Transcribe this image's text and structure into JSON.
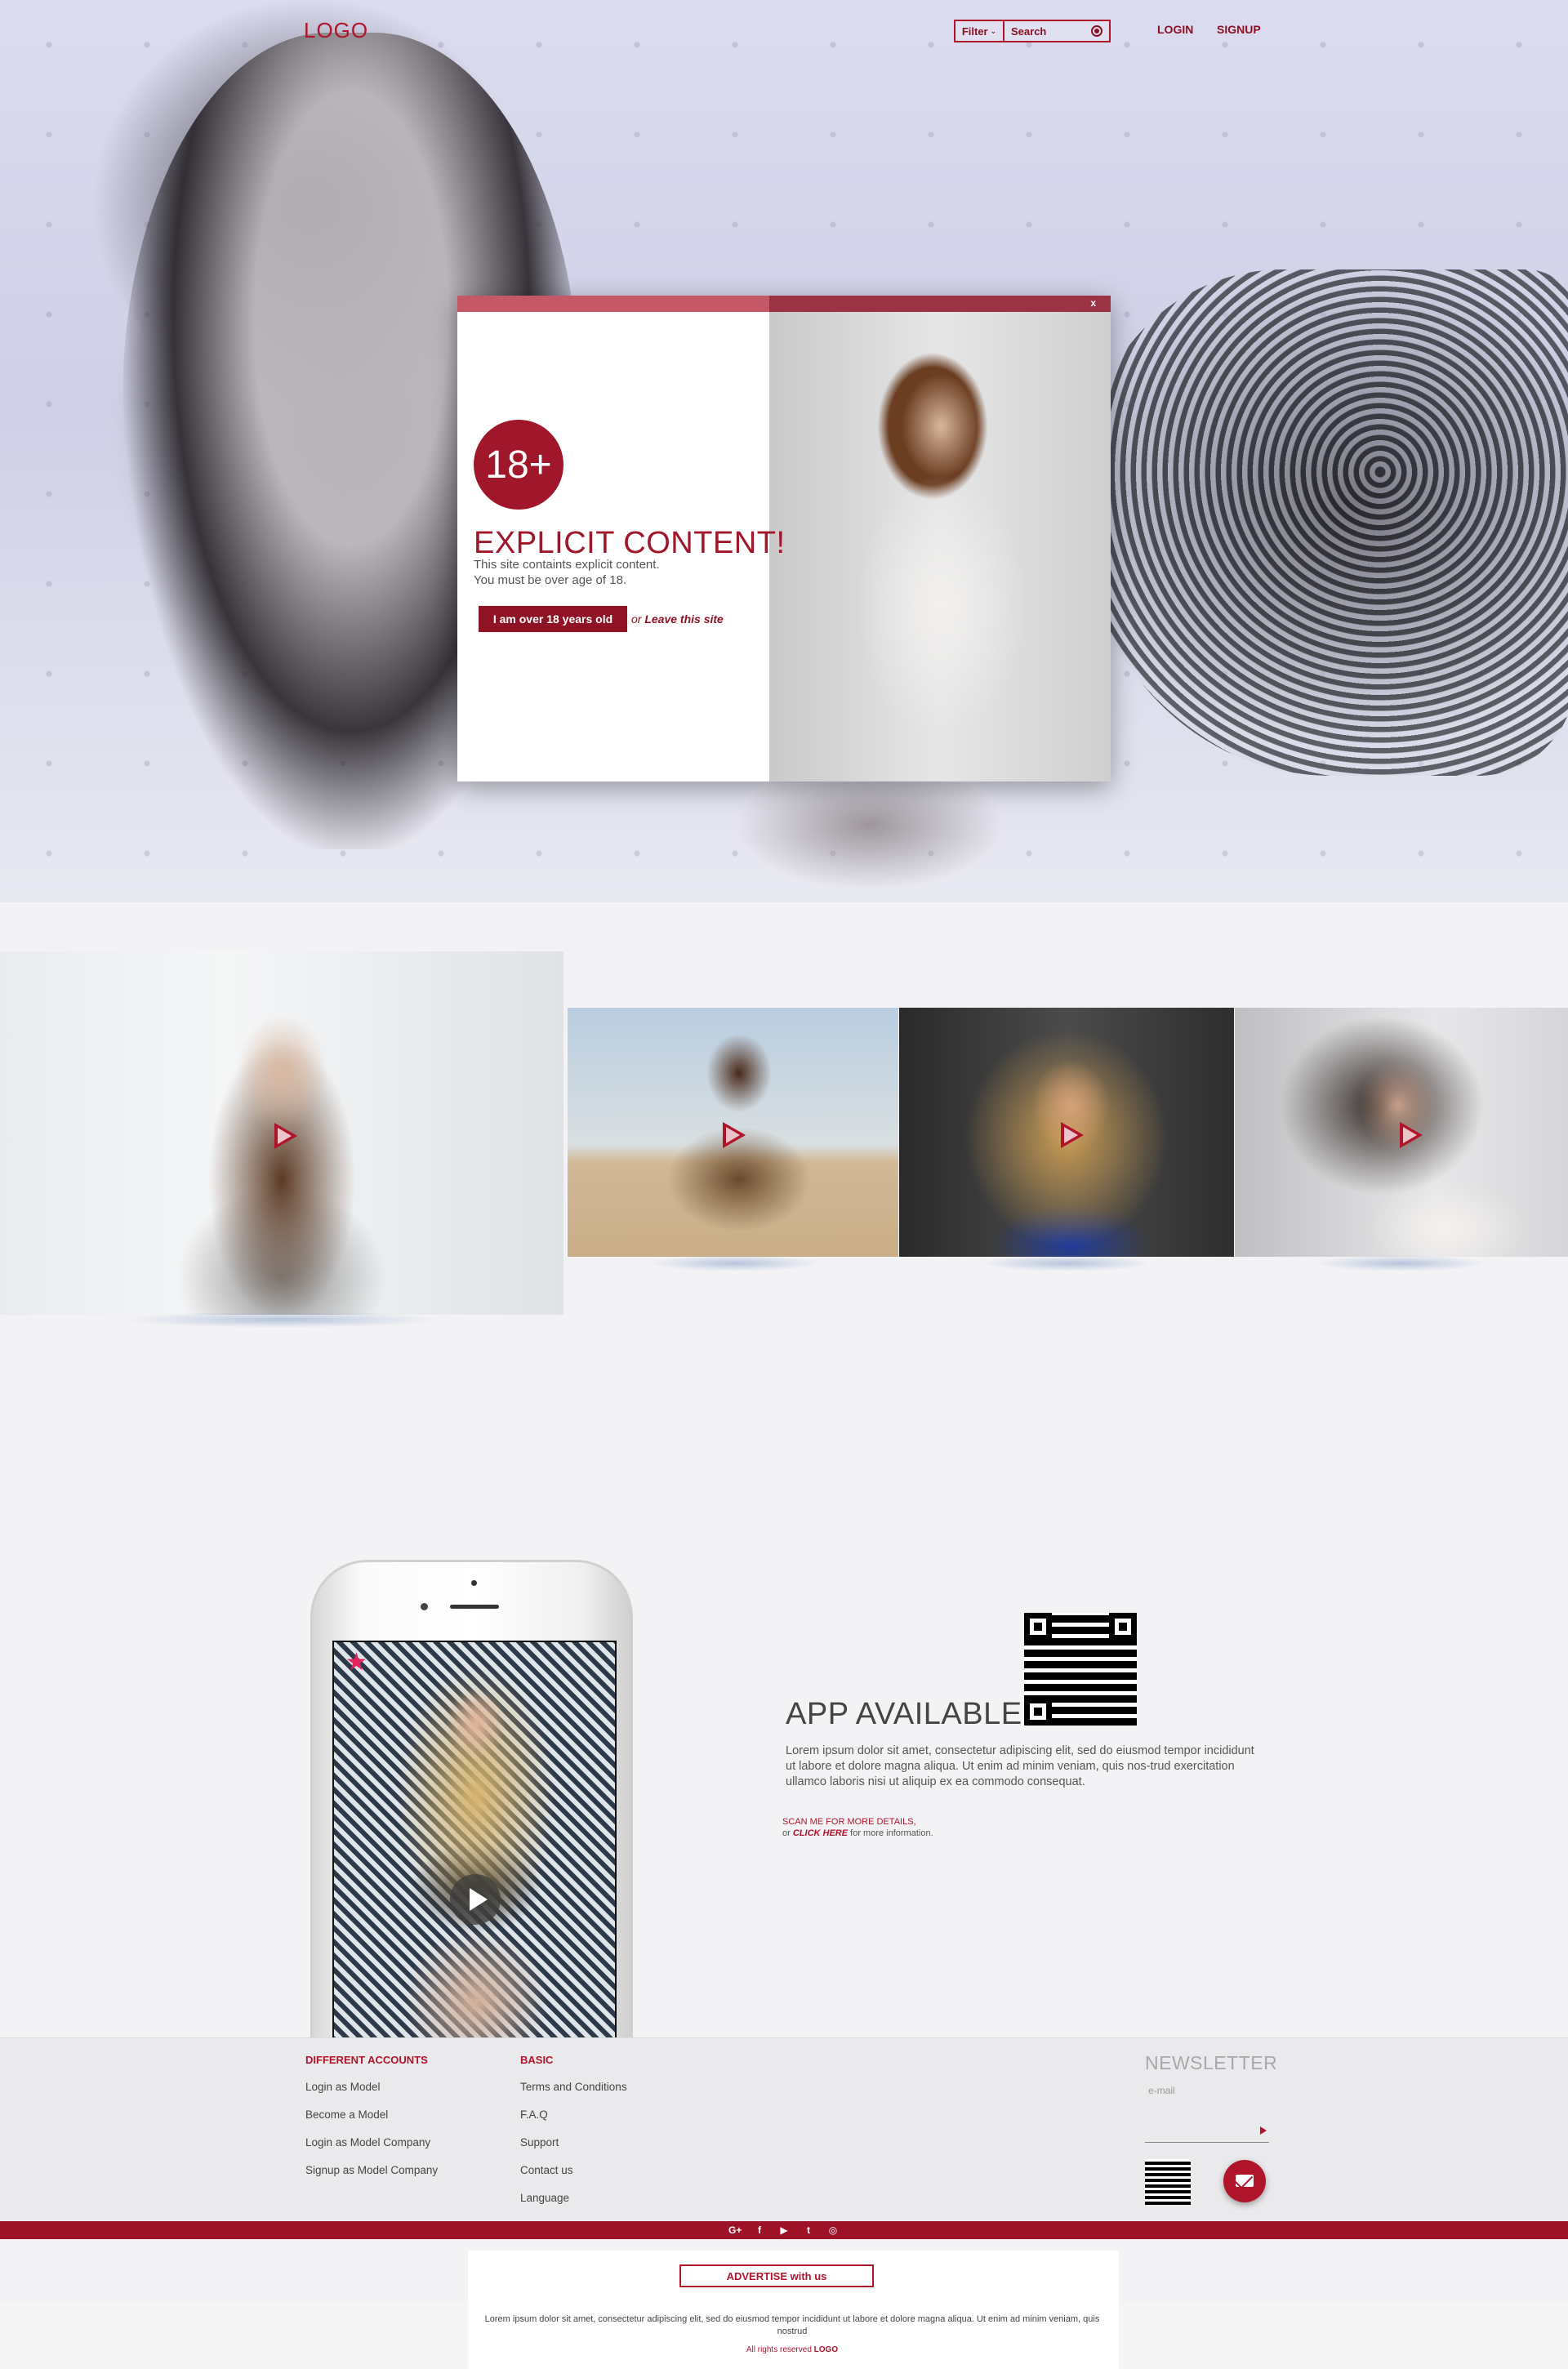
{
  "header": {
    "logo": "LOGO",
    "filter_label": "Filter",
    "search_placeholder": "Search",
    "login": "LOGIN",
    "signup": "SIGNUP"
  },
  "age_modal": {
    "close": "x",
    "badge": "18+",
    "title": "EXPLICIT CONTENT!",
    "line1": "This site containts explicit content.",
    "line2": "You must be over age of 18.",
    "confirm_button": "I am over 18 years old",
    "or_text": "or",
    "leave_link": "Leave this site"
  },
  "gallery": {
    "items": [
      {
        "icon": "play-icon"
      },
      {
        "icon": "play-icon"
      },
      {
        "icon": "play-icon"
      },
      {
        "icon": "play-icon"
      }
    ]
  },
  "app_section": {
    "title": "APP AVAILABLE",
    "description": "Lorem ipsum dolor sit amet, consectetur adipiscing elit, sed do eiusmod tempor incididunt ut labore et dolore magna aliqua. Ut enim ad minim veniam, quis nos-trud exercitation ullamco laboris nisi ut aliquip ex ea commodo consequat.",
    "scan_text": "SCAN ME FOR MORE DETAILS,",
    "or_text": "or",
    "click_here": "CLICK HERE",
    "more_info": "for more information."
  },
  "footer": {
    "col1_title": "DIFFERENT ACCOUNTS",
    "col1_links": [
      "Login as Model",
      "Become a Model",
      "Login as Model Company",
      "Signup as Model Company"
    ],
    "col2_title": "BASIC",
    "col2_links": [
      "Terms and Conditions",
      "F.A.Q",
      "Support",
      "Contact us",
      "Language"
    ],
    "newsletter_title": "NEWSLETTER",
    "email_placeholder": "e-mail",
    "social": [
      "G+",
      "f",
      "▶",
      "t",
      "◎"
    ],
    "advertise": "ADVERTISE with us",
    "bottom_text": "Lorem ipsum dolor sit amet, consectetur adipiscing elit, sed do eiusmod tempor incididunt ut labore et dolore magna aliqua. Ut enim ad minim veniam, quis nostrud",
    "rights_prefix": "All rights reserved",
    "rights_logo": "LOGO"
  },
  "colors": {
    "accent": "#b0142b",
    "dark_accent": "#9e1228",
    "modal_bar": "#c55866"
  }
}
